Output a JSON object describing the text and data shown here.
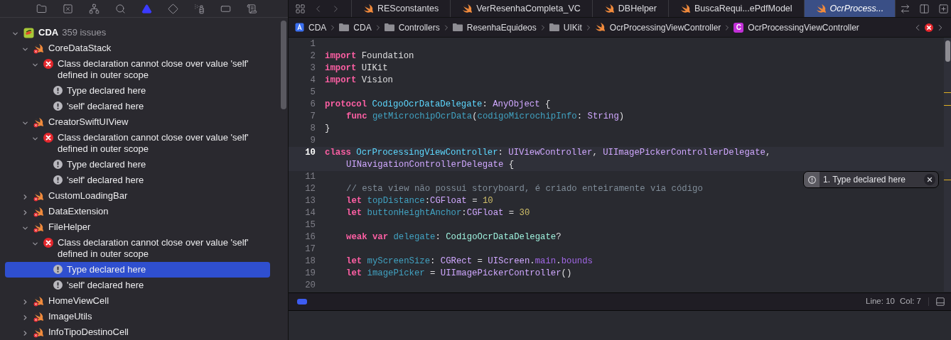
{
  "navigator_tabs": [
    {
      "kind": "project",
      "selected": false
    },
    {
      "kind": "source_control",
      "selected": false
    },
    {
      "kind": "symbols",
      "selected": false
    },
    {
      "kind": "find",
      "selected": false
    },
    {
      "kind": "issues",
      "selected": true
    },
    {
      "kind": "tests",
      "selected": false
    },
    {
      "kind": "debug",
      "selected": false
    },
    {
      "kind": "breakpoints",
      "selected": false
    },
    {
      "kind": "reports",
      "selected": false
    }
  ],
  "issue_tree": [
    {
      "kind": "project",
      "label": "CDA",
      "count": "359 issues",
      "expanded": true,
      "selected": false,
      "children": [
        {
          "kind": "file",
          "label": "CoreDataStack",
          "expanded": true,
          "selected": false,
          "children": [
            {
              "kind": "error",
              "label": "Class declaration cannot close over value 'self' defined in outer scope",
              "expanded": true,
              "selected": false,
              "children": [
                {
                  "kind": "note",
                  "label": "Type declared here",
                  "selected": false
                },
                {
                  "kind": "note",
                  "label": "'self' declared here",
                  "selected": false
                }
              ]
            }
          ]
        },
        {
          "kind": "file",
          "label": "CreatorSwiftUIView",
          "expanded": true,
          "selected": false,
          "children": [
            {
              "kind": "error",
              "label": "Class declaration cannot close over value 'self' defined in outer scope",
              "expanded": true,
              "selected": false,
              "children": [
                {
                  "kind": "note",
                  "label": "Type declared here",
                  "selected": false
                },
                {
                  "kind": "note",
                  "label": "'self' declared here",
                  "selected": false
                }
              ]
            }
          ]
        },
        {
          "kind": "file",
          "label": "CustomLoadingBar",
          "expanded": false,
          "selected": false
        },
        {
          "kind": "file",
          "label": "DataExtension",
          "expanded": false,
          "selected": false
        },
        {
          "kind": "file",
          "label": "FileHelper",
          "expanded": true,
          "selected": false,
          "children": [
            {
              "kind": "error",
              "label": "Class declaration cannot close over value 'self' defined in outer scope",
              "expanded": true,
              "selected": false,
              "children": [
                {
                  "kind": "note",
                  "label": "Type declared here",
                  "selected": true
                },
                {
                  "kind": "note",
                  "label": "'self' declared here",
                  "selected": false
                }
              ]
            }
          ]
        },
        {
          "kind": "file",
          "label": "HomeViewCell",
          "expanded": false,
          "selected": false
        },
        {
          "kind": "file",
          "label": "ImageUtils",
          "expanded": false,
          "selected": false
        },
        {
          "kind": "file",
          "label": "InfoTipoDestinoCell",
          "expanded": false,
          "selected": false
        }
      ]
    }
  ],
  "editor_tabs": [
    {
      "label": "RESconstantes",
      "selected": false
    },
    {
      "label": "VerResenhaCompleta_VC",
      "selected": false
    },
    {
      "label": "DBHelper",
      "selected": false
    },
    {
      "label": "BuscaRequi...ePdfModel",
      "selected": false
    },
    {
      "label": "OcrProcess...",
      "selected": true
    }
  ],
  "breadcrumb": [
    {
      "kind": "project",
      "label": "CDA"
    },
    {
      "kind": "folder",
      "label": "CDA"
    },
    {
      "kind": "folder",
      "label": "Controllers"
    },
    {
      "kind": "folder",
      "label": "ResenhaEquideos"
    },
    {
      "kind": "folder",
      "label": "UIKit"
    },
    {
      "kind": "swift_file",
      "label": "OcrProcessingViewController"
    },
    {
      "kind": "class",
      "badge": "C",
      "label": "OcrProcessingViewController"
    }
  ],
  "code_lines": [
    {
      "number": "1",
      "current": false
    },
    {
      "number": "2",
      "current": false,
      "indented": false,
      "tokens": [
        {
          "kind": "keyword",
          "text": "import"
        },
        {
          "kind": "plain",
          "text": " Foundation"
        }
      ]
    },
    {
      "number": "3",
      "current": false,
      "indented": false,
      "tokens": [
        {
          "kind": "keyword",
          "text": "import"
        },
        {
          "kind": "plain",
          "text": " UIKit"
        }
      ]
    },
    {
      "number": "4",
      "current": false,
      "indented": false,
      "tokens": [
        {
          "kind": "keyword",
          "text": "import"
        },
        {
          "kind": "plain",
          "text": " Vision"
        }
      ]
    },
    {
      "number": "5",
      "current": false
    },
    {
      "number": "6",
      "current": false,
      "indented": false,
      "tokens": [
        {
          "kind": "keyword",
          "text": "protocol"
        },
        {
          "kind": "declaration",
          "text": " CodigoOcrDataDelegate"
        },
        {
          "kind": "plain",
          "text": ": "
        },
        {
          "kind": "type",
          "text": "AnyObject"
        },
        {
          "kind": "plain",
          "text": " {"
        }
      ]
    },
    {
      "number": "7",
      "current": false,
      "indented": true,
      "tokens": [
        {
          "kind": "keyword",
          "text": "func"
        },
        {
          "kind": "member_declaration",
          "text": " getMicrochipOcrData"
        },
        {
          "kind": "plain",
          "text": "("
        },
        {
          "kind": "member_declaration",
          "text": "codigoMicrochipInfo"
        },
        {
          "kind": "plain",
          "text": ": "
        },
        {
          "kind": "type",
          "text": "String"
        },
        {
          "kind": "plain",
          "text": ")"
        }
      ]
    },
    {
      "number": "8",
      "current": false,
      "indented": false,
      "tokens": [
        {
          "kind": "plain",
          "text": "}"
        }
      ]
    },
    {
      "number": "9",
      "current": false
    },
    {
      "number": "10",
      "current": true,
      "indented": false,
      "tokens": [
        {
          "kind": "keyword",
          "text": "class"
        },
        {
          "kind": "declaration",
          "text": " OcrProcessingViewController"
        },
        {
          "kind": "plain",
          "text": ": "
        },
        {
          "kind": "type",
          "text": "UIViewController"
        },
        {
          "kind": "plain",
          "text": ", "
        },
        {
          "kind": "type",
          "text": "UIImagePickerControllerDelegate"
        },
        {
          "kind": "plain",
          "text": ","
        }
      ],
      "continuation": [
        {
          "kind": "type",
          "text": "UINavigationControllerDelegate"
        },
        {
          "kind": "plain",
          "text": " {"
        }
      ]
    },
    {
      "number": "11",
      "current": false
    },
    {
      "number": "12",
      "current": false,
      "indented": true,
      "tokens": [
        {
          "kind": "comment",
          "text": "// esta view não possui storyboard, é criado enteiramente via código"
        }
      ]
    },
    {
      "number": "13",
      "current": false,
      "indented": true,
      "tokens": [
        {
          "kind": "keyword",
          "text": "let"
        },
        {
          "kind": "member_declaration",
          "text": " topDistance"
        },
        {
          "kind": "plain",
          "text": ":"
        },
        {
          "kind": "type",
          "text": "CGFloat"
        },
        {
          "kind": "plain",
          "text": " = "
        },
        {
          "kind": "number",
          "text": "10"
        }
      ]
    },
    {
      "number": "14",
      "current": false,
      "indented": true,
      "tokens": [
        {
          "kind": "keyword",
          "text": "let"
        },
        {
          "kind": "member_declaration",
          "text": " buttonHeightAnchor"
        },
        {
          "kind": "plain",
          "text": ":"
        },
        {
          "kind": "type",
          "text": "CGFloat"
        },
        {
          "kind": "plain",
          "text": " = "
        },
        {
          "kind": "number",
          "text": "30"
        }
      ]
    },
    {
      "number": "15",
      "current": false
    },
    {
      "number": "16",
      "current": false,
      "indented": true,
      "tokens": [
        {
          "kind": "keyword",
          "text": "weak var"
        },
        {
          "kind": "member_declaration",
          "text": " delegate"
        },
        {
          "kind": "plain",
          "text": ": "
        },
        {
          "kind": "project_type",
          "text": "CodigoOcrDataDelegate"
        },
        {
          "kind": "plain",
          "text": "?"
        }
      ]
    },
    {
      "number": "17",
      "current": false
    },
    {
      "number": "18",
      "current": false,
      "indented": true,
      "tokens": [
        {
          "kind": "keyword",
          "text": "let"
        },
        {
          "kind": "member_declaration",
          "text": " myScreenSize"
        },
        {
          "kind": "plain",
          "text": ": "
        },
        {
          "kind": "type",
          "text": "CGRect"
        },
        {
          "kind": "plain",
          "text": " = "
        },
        {
          "kind": "type",
          "text": "UIScreen"
        },
        {
          "kind": "plain",
          "text": "."
        },
        {
          "kind": "member",
          "text": "main"
        },
        {
          "kind": "plain",
          "text": "."
        },
        {
          "kind": "member",
          "text": "bounds"
        }
      ]
    },
    {
      "number": "19",
      "current": false,
      "indented": true,
      "tokens": [
        {
          "kind": "keyword",
          "text": "let"
        },
        {
          "kind": "member_declaration",
          "text": " imagePicker"
        },
        {
          "kind": "plain",
          "text": " = "
        },
        {
          "kind": "type",
          "text": "UIImagePickerController"
        },
        {
          "kind": "plain",
          "text": "()"
        }
      ]
    },
    {
      "number": "20",
      "current": false
    }
  ],
  "annotation": {
    "text": "1. Type declared here"
  },
  "status_bar": {
    "debug_area_on": true,
    "line": "Line: 10",
    "column": "Col: 7"
  }
}
